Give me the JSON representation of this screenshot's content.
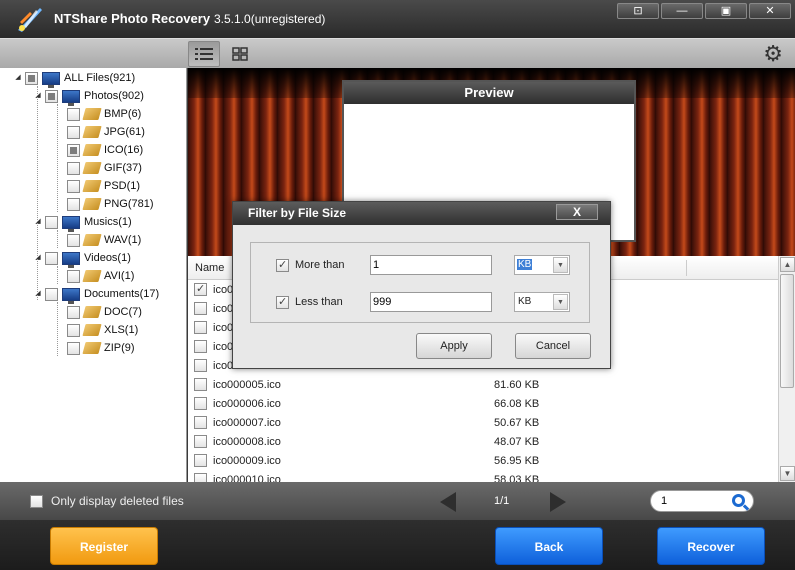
{
  "app": {
    "name": "NTShare Photo Recovery",
    "version": "3.5.1.0(unregistered)",
    "window_buttons": [
      "⊡",
      "—",
      "▣",
      "✕"
    ]
  },
  "tree": {
    "items": [
      {
        "label": "ALL Files(921)",
        "depth": 0,
        "icon": "computer-icon",
        "state": "partial"
      },
      {
        "label": "Photos(902)",
        "depth": 1,
        "icon": "computer-icon",
        "state": "partial"
      },
      {
        "label": "BMP(6)",
        "depth": 2,
        "icon": "tag-icon",
        "state": "unchecked"
      },
      {
        "label": "JPG(61)",
        "depth": 2,
        "icon": "tag-icon",
        "state": "unchecked"
      },
      {
        "label": "ICO(16)",
        "depth": 2,
        "icon": "tag-icon",
        "state": "partial"
      },
      {
        "label": "GIF(37)",
        "depth": 2,
        "icon": "tag-icon",
        "state": "unchecked"
      },
      {
        "label": "PSD(1)",
        "depth": 2,
        "icon": "tag-icon",
        "state": "unchecked"
      },
      {
        "label": "PNG(781)",
        "depth": 2,
        "icon": "tag-icon",
        "state": "unchecked"
      },
      {
        "label": "Musics(1)",
        "depth": 1,
        "icon": "computer-icon",
        "state": "unchecked"
      },
      {
        "label": "WAV(1)",
        "depth": 2,
        "icon": "tag-icon",
        "state": "unchecked"
      },
      {
        "label": "Videos(1)",
        "depth": 1,
        "icon": "computer-icon",
        "state": "unchecked"
      },
      {
        "label": "AVI(1)",
        "depth": 2,
        "icon": "tag-icon",
        "state": "unchecked"
      },
      {
        "label": "Documents(17)",
        "depth": 1,
        "icon": "computer-icon",
        "state": "unchecked"
      },
      {
        "label": "DOC(7)",
        "depth": 2,
        "icon": "tag-icon",
        "state": "unchecked"
      },
      {
        "label": "XLS(1)",
        "depth": 2,
        "icon": "tag-icon",
        "state": "unchecked"
      },
      {
        "label": "ZIP(9)",
        "depth": 2,
        "icon": "tag-icon",
        "state": "unchecked"
      }
    ]
  },
  "preview": {
    "title": "Preview"
  },
  "filelist": {
    "header_name": "Name",
    "rows": [
      {
        "name": "ico0",
        "size": "",
        "checked": true
      },
      {
        "name": "ico0",
        "size": "",
        "checked": false
      },
      {
        "name": "ico0",
        "size": "",
        "checked": false
      },
      {
        "name": "ico0",
        "size": "",
        "checked": false
      },
      {
        "name": "ico0",
        "size": "",
        "checked": false
      },
      {
        "name": "ico000005.ico",
        "size": "81.60 KB",
        "checked": false
      },
      {
        "name": "ico000006.ico",
        "size": "66.08 KB",
        "checked": false
      },
      {
        "name": "ico000007.ico",
        "size": "50.67 KB",
        "checked": false
      },
      {
        "name": "ico000008.ico",
        "size": "48.07 KB",
        "checked": false
      },
      {
        "name": "ico000009.ico",
        "size": "56.95 KB",
        "checked": false
      },
      {
        "name": "ico000010.ico",
        "size": "58.03 KB",
        "checked": false
      }
    ]
  },
  "bottom": {
    "only_deleted_label": "Only display deleted files",
    "page_info": "1/1",
    "page_input": "1"
  },
  "footer": {
    "register": "Register",
    "back": "Back",
    "recover": "Recover"
  },
  "dialog": {
    "title": "Filter by File Size",
    "close": "X",
    "more_than_label": "More than",
    "more_than_value": "1",
    "more_than_unit": "KB",
    "less_than_label": "Less than",
    "less_than_value": "999",
    "less_than_unit": "KB",
    "apply": "Apply",
    "cancel": "Cancel"
  }
}
